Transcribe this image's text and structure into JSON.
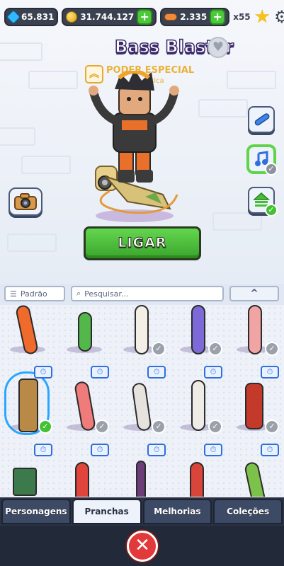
{
  "hud": {
    "currency1": "65.831",
    "coins": "31.744.127",
    "boards": "2.335",
    "multiplier": "x55",
    "plus_symbol": "+",
    "star_symbol": "★",
    "gear_symbol": "⚙"
  },
  "item": {
    "name": "Bass Blaster",
    "power_label": "PODER ESPECIAL",
    "power_sub": "sica",
    "chevron_symbol": "︽"
  },
  "actions": {
    "equip_label": "LIGAR"
  },
  "filter": {
    "sort_label": "Padrão",
    "search_placeholder": "Pesquisar...",
    "collapse_symbol": "^"
  },
  "grid": {
    "check_symbol": "✓",
    "timer_symbol": "⏱"
  },
  "tabs": [
    {
      "label": "Personagens"
    },
    {
      "label": "Pranchas"
    },
    {
      "label": "Melhorias"
    },
    {
      "label": "Coleções"
    }
  ],
  "close_symbol": "✕",
  "colors": {
    "accent_green": "#4cc93a",
    "accent_blue": "#2e6fdc",
    "tab_bar": "#2a3244",
    "close_red": "#e23a3a"
  }
}
